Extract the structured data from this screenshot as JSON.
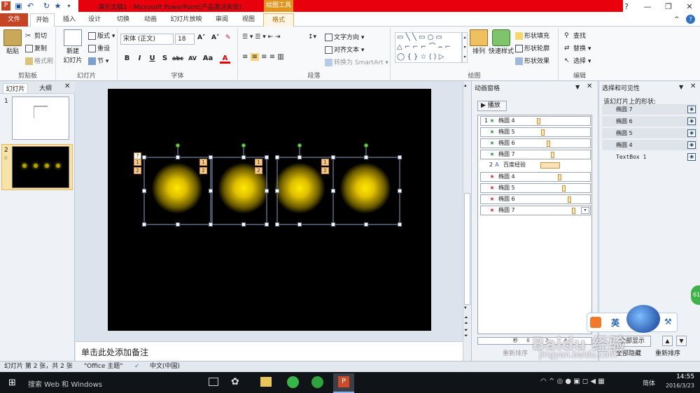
{
  "window": {
    "title": "演示文稿1 - Microsoft PowerPoint(产品激活失败)",
    "contextual_tab_group": "绘图工具",
    "controls": {
      "minimize": "—",
      "restore": "❐",
      "close": "✕",
      "help": "?"
    }
  },
  "tabs": [
    "文件",
    "开始",
    "插入",
    "设计",
    "切换",
    "动画",
    "幻灯片放映",
    "审阅",
    "视图",
    "格式"
  ],
  "ribbon": {
    "clipboard": {
      "paste": "粘贴",
      "cut": "剪切",
      "copy": "复制",
      "format_painter": "格式刷",
      "label": "剪贴板"
    },
    "slides": {
      "new_slide": "新建",
      "new_slide2": "幻灯片",
      "layout": "版式",
      "reset": "重设",
      "section": "节",
      "label": "幻灯片"
    },
    "font": {
      "name": "宋体 (正文)",
      "size": "18",
      "label": "字体",
      "buttons": [
        "B",
        "I",
        "U",
        "S",
        "abc",
        "AV",
        "Aa",
        "A"
      ]
    },
    "paragraph": {
      "text_direction": "文字方向",
      "align_text": "对齐文本",
      "convert_smartart": "转换为 SmartArt",
      "label": "段落"
    },
    "drawing": {
      "arrange": "排列",
      "quick_styles": "快速样式",
      "shape_fill": "形状填充",
      "shape_outline": "形状轮廓",
      "shape_effects": "形状效果",
      "label": "绘图"
    },
    "editing": {
      "find": "查找",
      "replace": "替换",
      "select": "选择",
      "label": "编辑"
    }
  },
  "left_pane": {
    "tabs": [
      "幻灯片",
      "大纲"
    ],
    "thumbnails": [
      {
        "num": "1"
      },
      {
        "num": "2",
        "marker": "☆"
      }
    ]
  },
  "slide": {
    "shape_tags": [
      {
        "top": "?",
        "mid": "1",
        "bot": "2"
      },
      {
        "mid": "1",
        "bot": "2"
      },
      {
        "mid": "1",
        "bot": "2"
      },
      {
        "mid": "1",
        "bot": "2"
      }
    ]
  },
  "notes_placeholder": "单击此处添加备注",
  "animation_pane": {
    "title": "动画窗格",
    "play": "播放",
    "rows": [
      {
        "index": "1",
        "name": "椭圆 4",
        "effect": "green"
      },
      {
        "index": "",
        "name": "椭圆 5",
        "effect": "green"
      },
      {
        "index": "",
        "name": "椭圆 6",
        "effect": "green"
      },
      {
        "index": "",
        "name": "椭圆 7",
        "effect": "green"
      },
      {
        "index": "2",
        "name": "百度经验",
        "effect": "text"
      },
      {
        "index": "",
        "name": "椭圆 4",
        "effect": "red"
      },
      {
        "index": "",
        "name": "椭圆 5",
        "effect": "red"
      },
      {
        "index": "",
        "name": "椭圆 6",
        "effect": "red"
      },
      {
        "index": "",
        "name": "椭圆 7",
        "effect": "red"
      }
    ],
    "timeline_unit": "秒",
    "timeline_ticks": [
      "0",
      "2",
      "4"
    ],
    "reorder": "重新排序"
  },
  "selection_pane": {
    "title": "选择和可见性",
    "subtitle": "该幻灯片上的形状:",
    "items": [
      "椭圆 7",
      "椭圆 6",
      "椭圆 5",
      "椭圆 4",
      "TextBox 1"
    ],
    "show_all": "全部显示",
    "hide_all": "全部隐藏",
    "reorder": "重新排序"
  },
  "overlay": {
    "lang": "英",
    "watermark": "Baidu 经验",
    "watermark_url": "jingyan.baidu.com",
    "badge": "61"
  },
  "status": {
    "slide_info": "幻灯片 第 2 张，共 2 张",
    "theme": "\"Office 主题\"",
    "language": "中文(中国)"
  },
  "taskbar": {
    "search": "搜索 Web 和 Windows",
    "time": "14:55",
    "date": "2016/3/23",
    "ime": "简体"
  },
  "colors": {
    "title_red": "#e8000d",
    "file_tab": "#c44423",
    "context_orange": "#e0941c",
    "glow": "#ffe800"
  }
}
